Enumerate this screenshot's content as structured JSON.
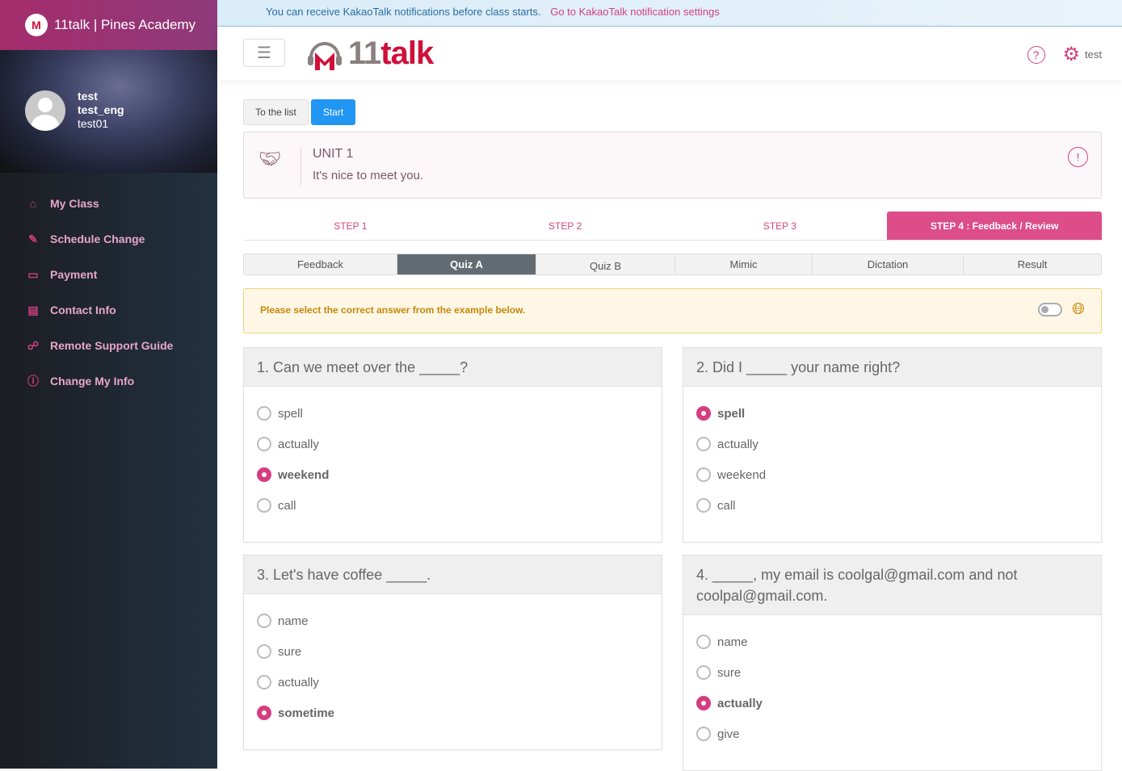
{
  "sidebar": {
    "brand": "11talk | Pines Academy",
    "profile": {
      "name": "test",
      "eng_name": "test_eng",
      "id": "test01"
    },
    "items": [
      {
        "label": "My Class",
        "icon": "school-icon"
      },
      {
        "label": "Schedule Change",
        "icon": "edit-icon"
      },
      {
        "label": "Payment",
        "icon": "credit-card-icon"
      },
      {
        "label": "Contact Info",
        "icon": "book-icon"
      },
      {
        "label": "Remote Support Guide",
        "icon": "handshake-icon"
      },
      {
        "label": "Change My Info",
        "icon": "info-icon"
      }
    ]
  },
  "banner": {
    "text": "You can receive KakaoTalk notifications before class starts.",
    "link": "Go to KakaoTalk notification settings"
  },
  "header": {
    "logo_num": "11",
    "logo_word": "talk",
    "user": "test"
  },
  "toolbar": {
    "to_list": "To the list",
    "start": "Start"
  },
  "unit": {
    "title": "UNIT 1",
    "subtitle": "It's nice to meet you."
  },
  "steps": [
    {
      "label": "STEP 1"
    },
    {
      "label": "STEP 2"
    },
    {
      "label": "STEP 3"
    },
    {
      "label": "STEP 4 : Feedback / Review",
      "active": true
    }
  ],
  "tabs": [
    {
      "label": "Feedback"
    },
    {
      "label": "Quiz A",
      "active": true
    },
    {
      "label": "Quiz B"
    },
    {
      "label": "Mimic"
    },
    {
      "label": "Dictation"
    },
    {
      "label": "Result"
    }
  ],
  "notice": {
    "text": "Please select the correct answer from the example below."
  },
  "questions": [
    {
      "text": "1. Can we meet over the _____?",
      "options": [
        "spell",
        "actually",
        "weekend",
        "call"
      ],
      "selected": 2
    },
    {
      "text": "2. Did I _____ your name right?",
      "options": [
        "spell",
        "actually",
        "weekend",
        "call"
      ],
      "selected": 0
    },
    {
      "text": "3. Let's have coffee _____.",
      "options": [
        "name",
        "sure",
        "actually",
        "sometime"
      ],
      "selected": 3
    },
    {
      "text": "4. _____, my email is coolgal@gmail.com and not coolpal@gmail.com.",
      "options": [
        "name",
        "sure",
        "actually",
        "give"
      ],
      "selected": 2
    }
  ],
  "colors": {
    "accent": "#dc4d8a",
    "primary": "#2196f3",
    "notice": "#c5870a"
  }
}
